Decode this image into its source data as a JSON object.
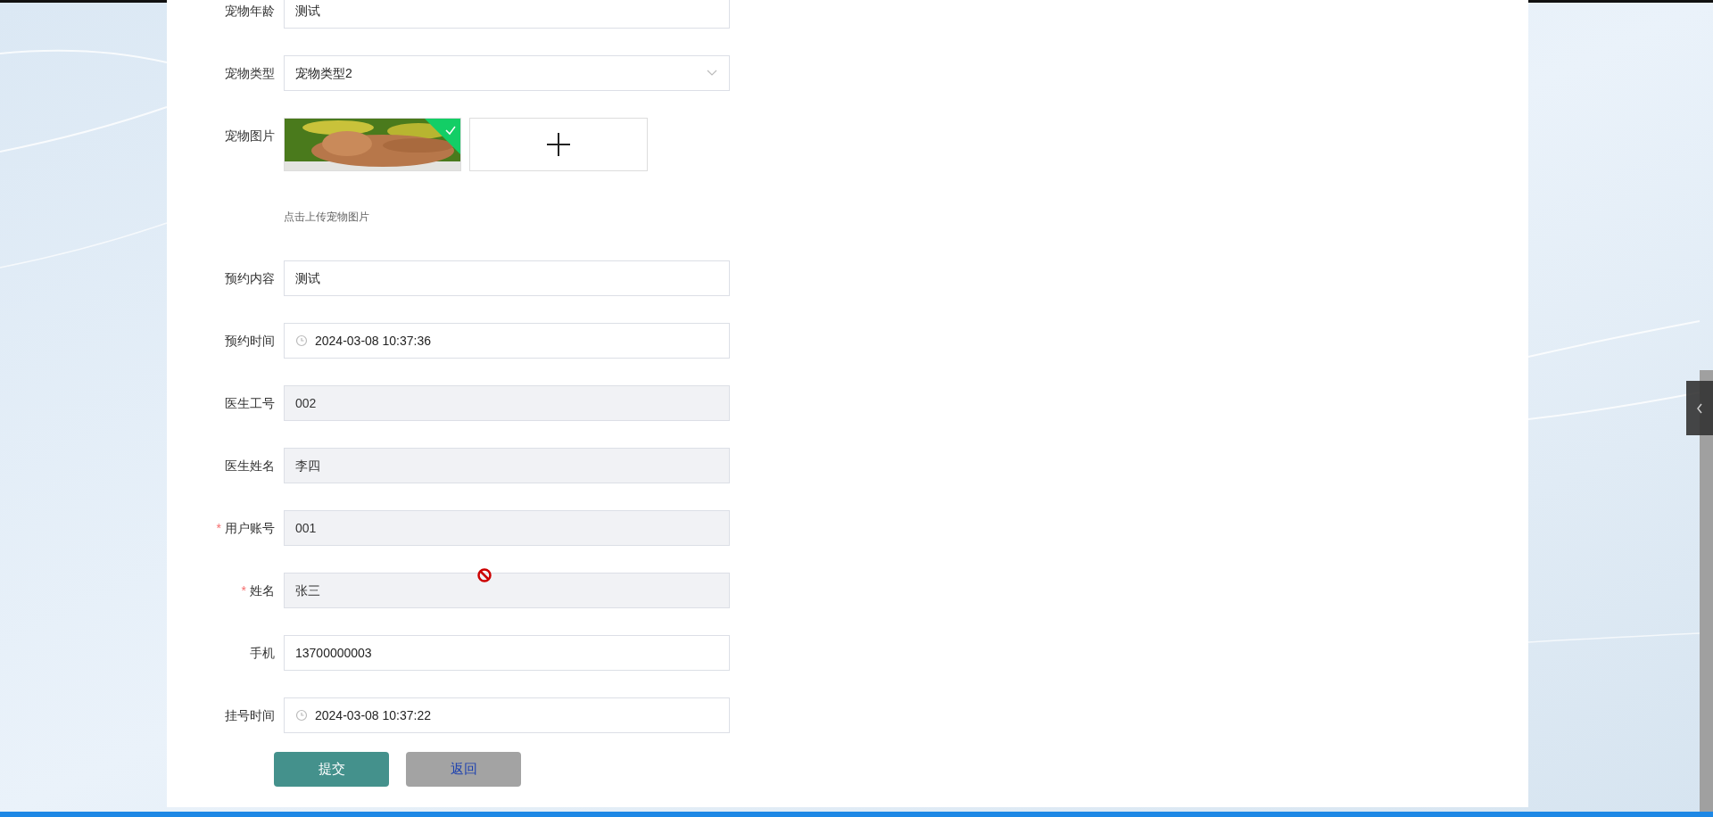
{
  "form": {
    "fields": [
      {
        "kind": "text",
        "label": "宠物年龄",
        "value": "测试",
        "disabled": false
      },
      {
        "kind": "select",
        "label": "宠物类型",
        "value": "宠物类型2",
        "disabled": false
      },
      {
        "label": "宠物图片",
        "hint": "点击上传宠物图片",
        "uploaded": true
      },
      {
        "kind": "text",
        "label": "预约内容",
        "value": "测试",
        "disabled": false
      },
      {
        "kind": "datetime",
        "label": "预约时间",
        "value": "2024-03-08 10:37:36",
        "disabled": false
      },
      {
        "kind": "text",
        "label": "医生工号",
        "value": "002",
        "disabled": true
      },
      {
        "kind": "text",
        "label": "医生姓名",
        "value": "李四",
        "disabled": true
      },
      {
        "kind": "text",
        "label": "用户账号",
        "value": "001",
        "disabled": true,
        "required_mark": "*"
      },
      {
        "kind": "text",
        "label": "姓名",
        "value": "张三",
        "disabled": true,
        "required_mark": "*"
      },
      {
        "kind": "text",
        "label": "手机",
        "value": "13700000003",
        "disabled": false
      },
      {
        "kind": "datetime",
        "label": "挂号时间",
        "value": "2024-03-08 10:37:22",
        "disabled": false
      }
    ],
    "buttons": [
      {
        "kind": "primary",
        "label": "提交"
      },
      {
        "kind": "back",
        "label": "返回"
      }
    ]
  }
}
